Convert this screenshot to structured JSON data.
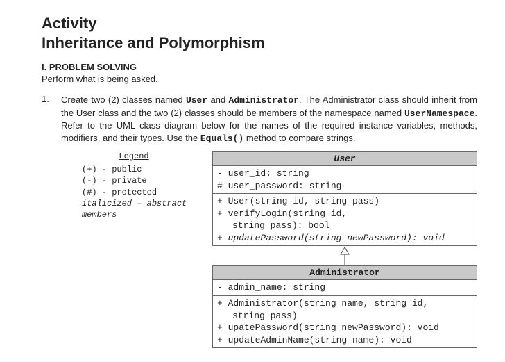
{
  "title_line1": "Activity",
  "title_line2": "Inheritance and Polymorphism",
  "section": {
    "head": "I. PROBLEM SOLVING",
    "sub": "Perform what is being asked."
  },
  "problem": {
    "num": "1.",
    "text_a": "Create two (2) classes named ",
    "kw_user": "User",
    "text_b": " and ",
    "kw_admin": "Administrator",
    "text_c": ". The Administrator class should inherit from the User class and the two (2) classes should be members of the namespace named ",
    "kw_ns": "UserNamespace",
    "text_d": ". Refer to the UML class diagram below for the names of the required instance variables, methods, modifiers, and their types. Use the ",
    "kw_eq": "Equals()",
    "text_e": " method to compare strings."
  },
  "legend": {
    "title": "Legend",
    "l1": "(+) - public",
    "l2": "(-) - private",
    "l3": "(#) - protected",
    "l4": "italicized – abstract members"
  },
  "uml": {
    "user": {
      "name": "User",
      "attrs": [
        "- user_id: string",
        "# user_password: string"
      ],
      "ops": [
        "+ User(string id, string pass)",
        "+ verifyLogin(string id,",
        "    string pass): bool",
        "+ updatePassword(string newPassword): void"
      ],
      "op_italic_index": 3
    },
    "admin": {
      "name": "Administrator",
      "attrs": [
        "- admin_name: string"
      ],
      "ops": [
        "+ Administrator(string name, string id,",
        "    string pass)",
        "+ upatePassword(string newPassword): void",
        "+ updateAdminName(string name): void"
      ]
    }
  }
}
